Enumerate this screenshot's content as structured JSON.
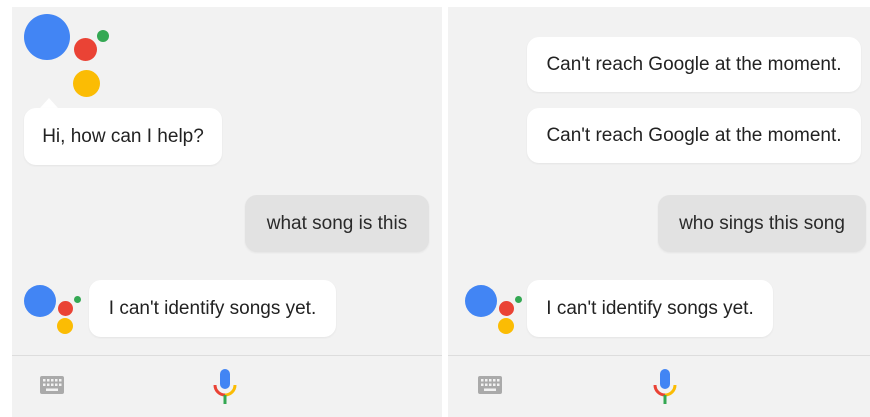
{
  "left_panel": {
    "greeting": "Hi, how can I help?",
    "user_query": "what song is this",
    "assistant_reply": "I can't identify songs yet."
  },
  "right_panel": {
    "error_1": "Can't reach Google at the moment.",
    "error_2": "Can't reach Google at the moment.",
    "user_query": "who sings this song",
    "assistant_reply": "I can't identify songs yet."
  },
  "colors": {
    "blue": "#4285f4",
    "red": "#ea4335",
    "yellow": "#fbbc04",
    "green": "#34a853",
    "panel_bg": "#f2f2f2",
    "user_bubble": "#e2e2e2"
  },
  "icons": {
    "keyboard": "keyboard-icon",
    "microphone": "microphone-icon",
    "assistant_logo": "google-assistant-logo-icon"
  }
}
